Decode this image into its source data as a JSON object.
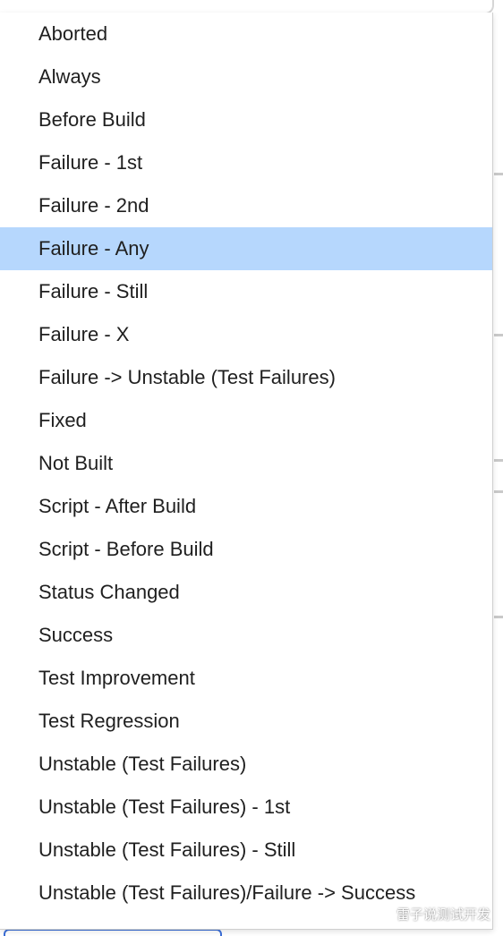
{
  "dropdown": {
    "selected_index": 5,
    "options": [
      "Aborted",
      "Always",
      "Before Build",
      "Failure - 1st",
      "Failure - 2nd",
      "Failure - Any",
      "Failure - Still",
      "Failure - X",
      "Failure -> Unstable (Test Failures)",
      "Fixed",
      "Not Built",
      "Script - After Build",
      "Script - Before Build",
      "Status Changed",
      "Success",
      "Test Improvement",
      "Test Regression",
      "Unstable (Test Failures)",
      "Unstable (Test Failures) - 1st",
      "Unstable (Test Failures) - Still",
      "Unstable (Test Failures)/Failure -> Success"
    ]
  },
  "watermark": {
    "text": "雷子说测试开发",
    "icon": "wechat-icon"
  },
  "colors": {
    "selected_bg": "#b6d7fd",
    "text": "#1f1f1f",
    "focus_border": "#3b6fd8"
  }
}
